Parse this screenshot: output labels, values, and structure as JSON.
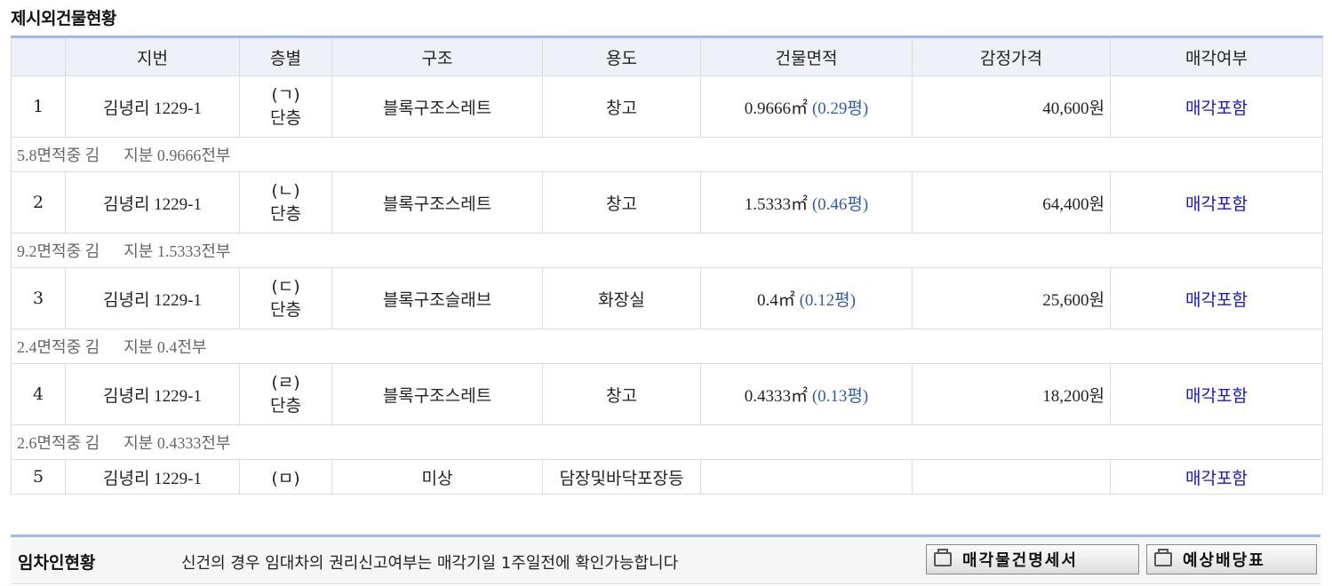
{
  "section": {
    "title": "제시외건물현황"
  },
  "table": {
    "headers": [
      "",
      "지번",
      "층별",
      "구조",
      "용도",
      "건물면적",
      "감정가격",
      "매각여부"
    ],
    "rows": [
      {
        "no": "1",
        "lot": "김녕리 1229-1",
        "floor_mark": "(ㄱ)",
        "floor": "단층",
        "structure": "블록구조스레트",
        "usage": "창고",
        "area": "0.9666㎡",
        "pyeong": "(0.29평)",
        "price": "40,600원",
        "sale": "매각포함",
        "note": "5.8면적중 김      지분 0.9666전부"
      },
      {
        "no": "2",
        "lot": "김녕리 1229-1",
        "floor_mark": "(ㄴ)",
        "floor": "단층",
        "structure": "블록구조스레트",
        "usage": "창고",
        "area": "1.5333㎡",
        "pyeong": "(0.46평)",
        "price": "64,400원",
        "sale": "매각포함",
        "note": "9.2면적중 김      지분 1.5333전부"
      },
      {
        "no": "3",
        "lot": "김녕리 1229-1",
        "floor_mark": "(ㄷ)",
        "floor": "단층",
        "structure": "블록구조슬래브",
        "usage": "화장실",
        "area": "0.4㎡",
        "pyeong": "(0.12평)",
        "price": "25,600원",
        "sale": "매각포함",
        "note": "2.4면적중 김      지분 0.4전부"
      },
      {
        "no": "4",
        "lot": "김녕리 1229-1",
        "floor_mark": "(ㄹ)",
        "floor": "단층",
        "structure": "블록구조스레트",
        "usage": "창고",
        "area": "0.4333㎡",
        "pyeong": "(0.13평)",
        "price": "18,200원",
        "sale": "매각포함",
        "note": "2.6면적중 김      지분 0.4333전부"
      },
      {
        "no": "5",
        "lot": "김녕리 1229-1",
        "floor_mark": "(ㅁ)",
        "structure": "미상",
        "usage": "담장및바닥포장등",
        "sale": "매각포함"
      }
    ]
  },
  "tenant": {
    "label": "임차인현황",
    "message": "신건의 경우 임대차의 권리신고여부는 매각기일 1주일전에 확인가능합니다",
    "buttons": [
      {
        "label": "매각물건명세서",
        "icon": "document-icon"
      },
      {
        "label": "예상배당표",
        "icon": "document-icon"
      }
    ]
  }
}
